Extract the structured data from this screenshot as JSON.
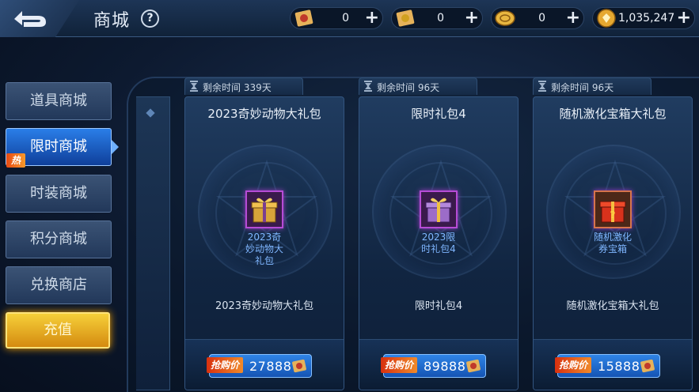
{
  "header": {
    "title": "商城",
    "help_label": "?"
  },
  "resources": [
    {
      "icon": "red-voucher-icon",
      "value": "0",
      "plus": "+"
    },
    {
      "icon": "gold-voucher-icon",
      "value": "0",
      "plus": "+"
    },
    {
      "icon": "gold-coin-icon",
      "value": "0",
      "plus": "+"
    },
    {
      "icon": "diamond-coupon-icon",
      "value": "1,035,247",
      "plus": "+"
    }
  ],
  "sidebar": {
    "items": [
      {
        "label": "道具商城"
      },
      {
        "label": "限时商城",
        "badge": "热"
      },
      {
        "label": "时装商城"
      },
      {
        "label": "积分商城"
      },
      {
        "label": "兑换商店"
      }
    ],
    "recharge": "充值"
  },
  "cards": [
    {
      "timer": "剩余时间 339天",
      "title": "2023奇妙动物大礼包",
      "item_name": "2023奇\n妙动物大\n礼包",
      "item_icon": "gold-gift-box-icon",
      "desc": "2023奇妙动物大礼包",
      "price_tag": "抢购价",
      "price": "27888"
    },
    {
      "timer": "剩余时间 96天",
      "title": "限时礼包4",
      "item_name": "2023限\n时礼包4",
      "item_icon": "purple-gift-box-icon",
      "desc": "限时礼包4",
      "price_tag": "抢购价",
      "price": "89888"
    },
    {
      "timer": "剩余时间 96天",
      "title": "随机激化宝箱大礼包",
      "item_name": "随机激化\n券宝箱",
      "item_icon": "red-mystery-box-icon",
      "desc": "随机激化宝箱大礼包",
      "price_tag": "抢购价",
      "price": "15888"
    }
  ]
}
